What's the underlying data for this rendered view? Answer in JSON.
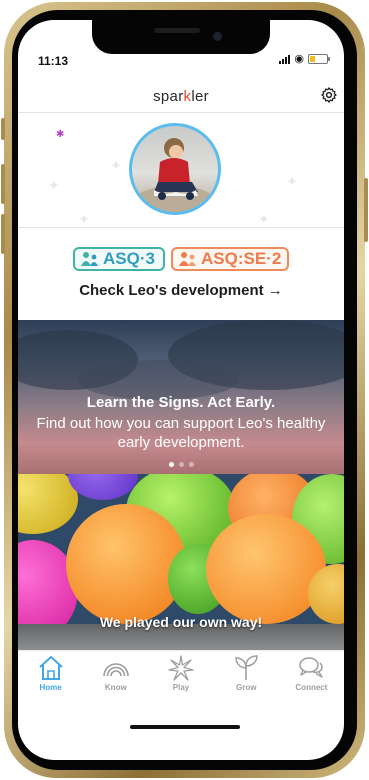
{
  "status": {
    "time": "11:13"
  },
  "header": {
    "logo_pre": "spar",
    "logo_k": "k",
    "logo_post": "ler"
  },
  "badges": {
    "asq3": "ASQ·3",
    "asqse": "ASQ:SE·2"
  },
  "check_link": "Check Leo's development →",
  "cards": [
    {
      "title": "Learn the Signs. Act Early.",
      "subtitle": "Find out how you can support Leo's healthy early development.",
      "page_count": 3,
      "active_page": 1
    },
    {
      "title": "We played our own way!"
    }
  ],
  "tabs": [
    {
      "label": "Home",
      "icon": "home-icon",
      "active": true
    },
    {
      "label": "Know",
      "icon": "rainbow-icon",
      "active": false
    },
    {
      "label": "Play",
      "icon": "star-icon",
      "active": false
    },
    {
      "label": "Grow",
      "icon": "sprout-icon",
      "active": false
    },
    {
      "label": "Connect",
      "icon": "chat-bubbles-icon",
      "active": false
    }
  ],
  "colors": {
    "accent": "#43a7e6",
    "avatar_ring": "#5bbcf0",
    "asq3": "#2f9ec2",
    "asqse": "#ef7a4a"
  }
}
